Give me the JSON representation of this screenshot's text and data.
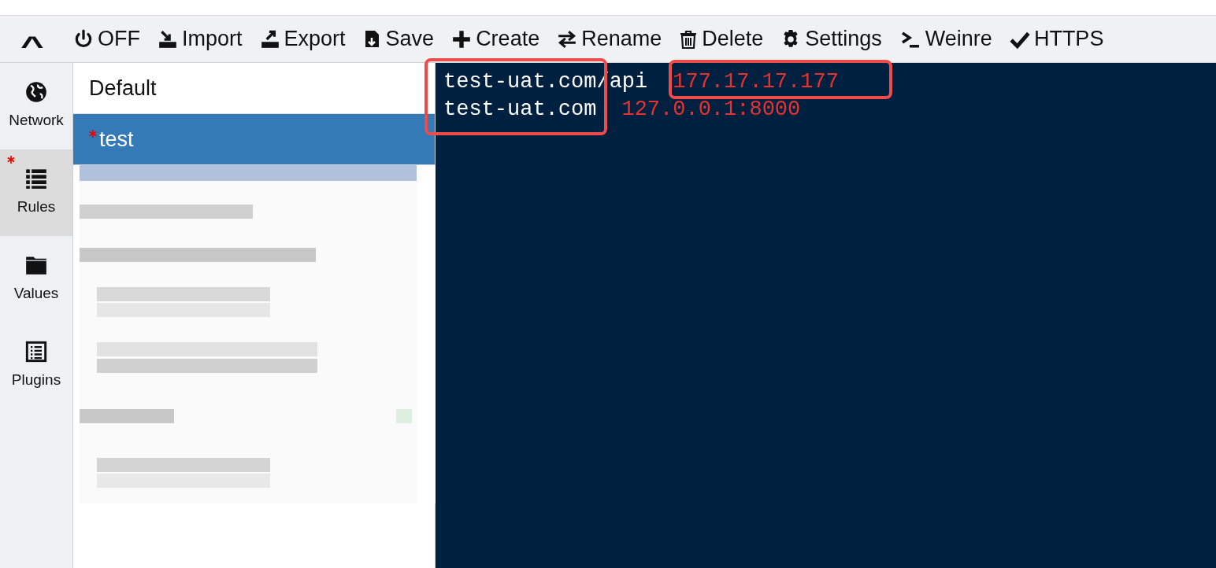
{
  "toolbar": {
    "collapse": "^",
    "buttons": [
      {
        "kind": "power",
        "label": "OFF"
      },
      {
        "kind": "import",
        "label": "Import"
      },
      {
        "kind": "export",
        "label": "Export"
      },
      {
        "kind": "save",
        "label": "Save"
      },
      {
        "kind": "create",
        "label": "Create"
      },
      {
        "kind": "rename",
        "label": "Rename"
      },
      {
        "kind": "delete",
        "label": "Delete"
      },
      {
        "kind": "settings",
        "label": "Settings"
      },
      {
        "kind": "weinre",
        "label": "Weinre"
      },
      {
        "kind": "https",
        "label": "HTTPS"
      }
    ]
  },
  "nav": [
    {
      "kind": "network",
      "label": "Network",
      "selected": false,
      "modified": false
    },
    {
      "kind": "rules",
      "label": "Rules",
      "selected": true,
      "modified": true
    },
    {
      "kind": "values",
      "label": "Values",
      "selected": false,
      "modified": false
    },
    {
      "kind": "plugins",
      "label": "Plugins",
      "selected": false,
      "modified": false
    }
  ],
  "rule_groups": [
    {
      "label": "Default",
      "selected": false,
      "modified": false
    },
    {
      "label": "test",
      "selected": true,
      "modified": true
    }
  ],
  "editor": {
    "lines": [
      {
        "pattern": "test-uat.com/api",
        "target": "177.17.17.177"
      },
      {
        "pattern": "test-uat.com",
        "target": "127.0.0.1:8000"
      }
    ]
  }
}
